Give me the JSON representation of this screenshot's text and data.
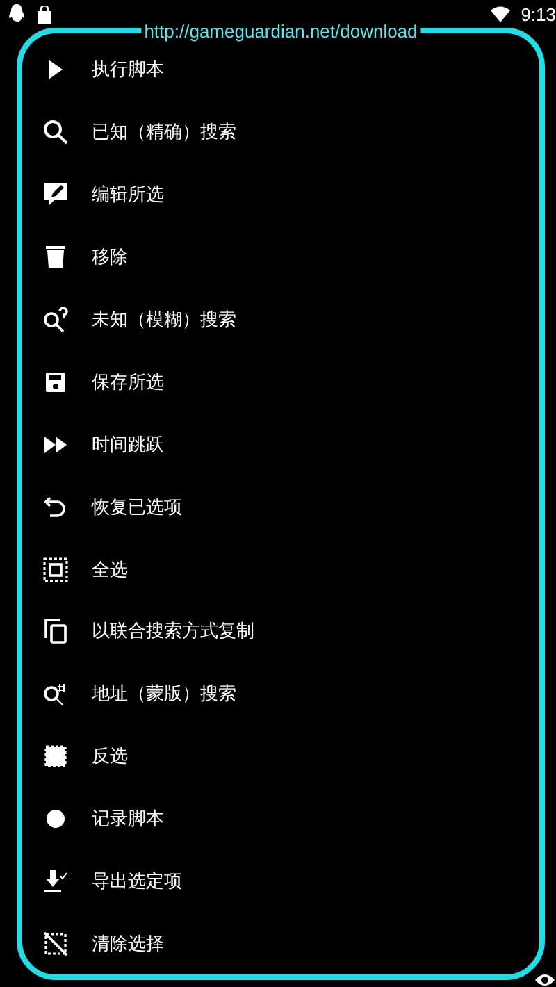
{
  "status_bar": {
    "time": "9:13"
  },
  "menu": {
    "url": "http://gameguardian.net/download",
    "items": [
      {
        "label": "执行脚本"
      },
      {
        "label": "已知（精确）搜索"
      },
      {
        "label": "编辑所选"
      },
      {
        "label": "移除"
      },
      {
        "label": "未知（模糊）搜索"
      },
      {
        "label": "保存所选"
      },
      {
        "label": "时间跳跃"
      },
      {
        "label": "恢复已选项"
      },
      {
        "label": "全选"
      },
      {
        "label": "以联合搜索方式复制"
      },
      {
        "label": "地址（蒙版）搜索"
      },
      {
        "label": "反选"
      },
      {
        "label": "记录脚本"
      },
      {
        "label": "导出选定项"
      },
      {
        "label": "清除选择"
      }
    ]
  }
}
